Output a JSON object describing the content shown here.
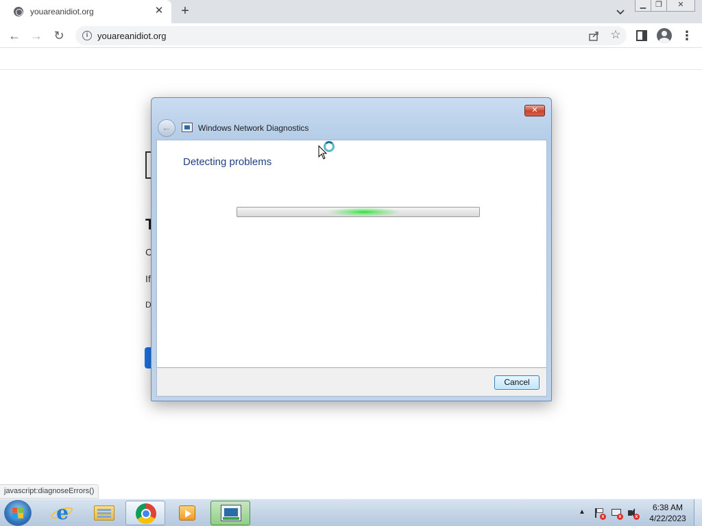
{
  "browser": {
    "tab_title": "youareanidiot.org",
    "tab_close": "✕",
    "new_tab": "+",
    "url": "youareanidiot.org",
    "window_controls": {
      "minimize": "▁",
      "restore": "❐",
      "close": "✕"
    }
  },
  "toolbar": {
    "back": "←",
    "forward": "→",
    "reload": "↻",
    "star": "☆",
    "menu": "⋮"
  },
  "page": {
    "heading_fragment": "T",
    "line1_fragment": "C",
    "line2_fragment": "If",
    "line3_fragment": "D"
  },
  "dialog": {
    "title": "Windows Network Diagnostics",
    "close": "✕",
    "back": "←",
    "heading": "Detecting problems",
    "cancel_label": "Cancel"
  },
  "status_bubble": "javascript:diagnoseErrors()",
  "taskbar": {
    "tray_arrow": "▲",
    "time": "6:38 AM",
    "date": "4/22/2023"
  },
  "colors": {
    "dialog_heading": "#1e3f82",
    "progress_glow": "#2fe23a",
    "accent_blue": "#1a73e8"
  }
}
